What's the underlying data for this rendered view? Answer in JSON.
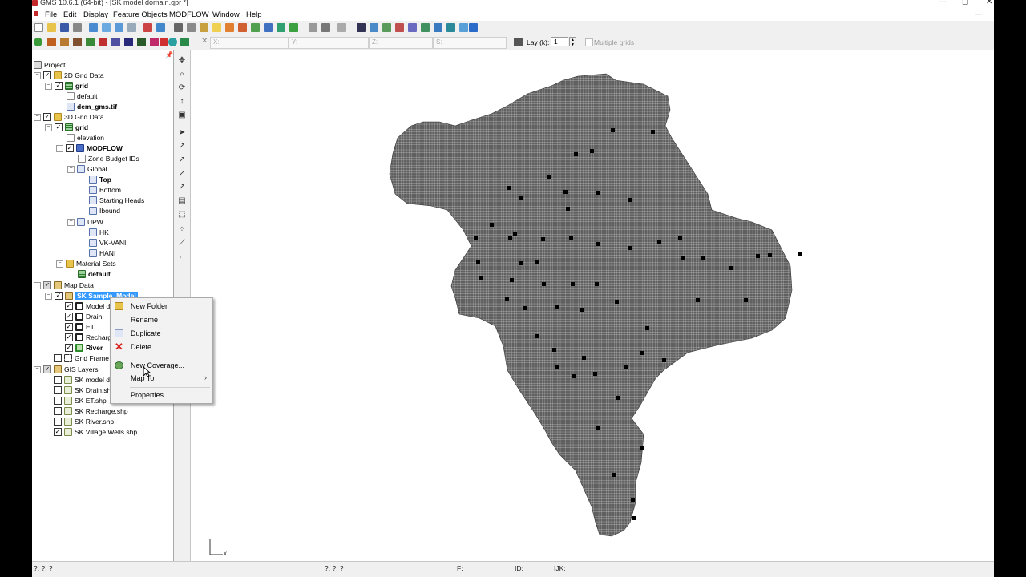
{
  "window": {
    "title": "GMS 10.6.1 (64-bit) - [SK model domain.gpr *]",
    "min_glyph": "—",
    "max_glyph": "◻",
    "close_glyph": "✕"
  },
  "menu": [
    "File",
    "Edit",
    "Display",
    "Feature Objects",
    "MODFLOW",
    "Window",
    "Help"
  ],
  "toolbar": {
    "coord_x": "X:",
    "coord_y": "Y:",
    "coord_z": "Z:",
    "coord_s": "S:",
    "lay_label": "Lay (k):",
    "lay_value": "1",
    "multiple_grids": "Multiple grids"
  },
  "tree": [
    {
      "label": "Project"
    },
    {
      "label": "2D Grid Data"
    },
    {
      "label": "grid"
    },
    {
      "label": "default"
    },
    {
      "label": "dem_gms.tif"
    },
    {
      "label": "3D Grid Data"
    },
    {
      "label": "grid"
    },
    {
      "label": "elevation"
    },
    {
      "label": "MODFLOW"
    },
    {
      "label": "Zone Budget IDs"
    },
    {
      "label": "Global"
    },
    {
      "label": "Top"
    },
    {
      "label": "Bottom"
    },
    {
      "label": "Starting Heads"
    },
    {
      "label": "Ibound"
    },
    {
      "label": "UPW"
    },
    {
      "label": "HK"
    },
    {
      "label": "VK-VANI"
    },
    {
      "label": "HANI"
    },
    {
      "label": "Material Sets"
    },
    {
      "label": "default"
    },
    {
      "label": "Map Data"
    },
    {
      "label": "SK Sample_Model"
    },
    {
      "label": "Model do"
    },
    {
      "label": "Drain"
    },
    {
      "label": "ET"
    },
    {
      "label": "Recharg"
    },
    {
      "label": "River"
    },
    {
      "label": "Grid Frame"
    },
    {
      "label": "GIS Layers"
    },
    {
      "label": "SK model do"
    },
    {
      "label": "SK Drain.shp"
    },
    {
      "label": "SK ET.shp"
    },
    {
      "label": "SK Recharge.shp"
    },
    {
      "label": "SK River.shp"
    },
    {
      "label": "SK Village Wells.shp"
    }
  ],
  "context_menu": [
    {
      "label": "New Folder",
      "icon": "folder-icon"
    },
    {
      "label": "Rename",
      "icon": ""
    },
    {
      "label": "Duplicate",
      "icon": "duplicate-icon"
    },
    {
      "label": "Delete",
      "icon": "delete-icon"
    },
    {
      "label": "New Coverage...",
      "icon": "coverage-icon"
    },
    {
      "label": "Map To",
      "icon": "",
      "submenu_glyph": "›"
    },
    {
      "label": "Properties...",
      "icon": ""
    }
  ],
  "status": {
    "xyz1": "?, ?, ?",
    "xyz2": "?, ?, ?",
    "f": "F:",
    "id": "ID:",
    "ijk": "IJK:"
  },
  "graphics": {
    "triad_x": "x",
    "mesh_fill": "#5f5f5f",
    "mesh_line": "#c8c8c8"
  },
  "colors": {
    "selection": "#3399ff",
    "delete": "#d92020"
  }
}
